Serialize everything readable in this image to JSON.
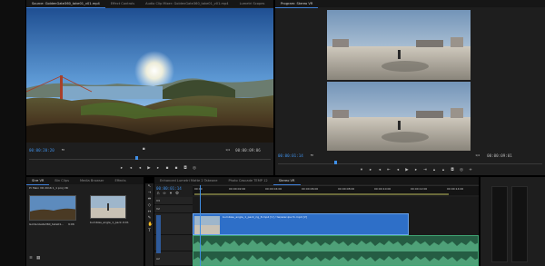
{
  "source_monitor": {
    "tabs": [
      "Source: GoldenGate360_take01_v01.mp4",
      "Effect Controls",
      "Audio Clip Mixer: GoldenGate360_take01_v01.mp4",
      "Lumetri Scopes",
      "Audio Track Mixe"
    ],
    "timecode_in": "00:00:20:20",
    "fit_label": "Fit",
    "fraction": "1/4",
    "timecode_out": "00:00:09:06"
  },
  "program_monitor": {
    "tabs": [
      "Program: Stereo VR"
    ],
    "timecode_in": "00:00:01:14",
    "fit_label": "Fit",
    "fraction": "1/4",
    "timecode_out": "00:00:09:01"
  },
  "project_panel": {
    "tabs": [
      "Stre VR",
      "Bin Clips",
      "Media Browser",
      "Effects"
    ],
    "path": "Pr Main VR 2016 1_1 proj VR",
    "items": [
      {
        "label": "GoldenGate360_take01...",
        "duration": "9:06"
      },
      {
        "label": "bumbles_angle_1_pack...",
        "duration": "9:01"
      }
    ]
  },
  "timeline": {
    "tabs": [
      "Enhanced Lumetri Matte 2 Takeone",
      "Photo Cascade TEMP 12",
      "Stereo VR"
    ],
    "timecode": "00:00:01:14",
    "ruler_labels": [
      "00:00",
      "00:00:02:00",
      "00:00:04:00",
      "00:00:06:00",
      "00:00:08:00",
      "00:00:10:00",
      "00:00:12:00",
      "00:00:14:00"
    ],
    "tracks": {
      "video": [
        "V3",
        "V2",
        "V1"
      ],
      "audio": [
        "A1",
        "A2"
      ]
    },
    "clip_title": "bumbles_angle_1_pack_rig_8.mp4 [V] / tw/ezer-lpa fx.mp4 [V]",
    "colors": {
      "accent": "#3f8fe6",
      "video_clip": "#2e6fc8",
      "audio_clip": "#255d43"
    }
  }
}
